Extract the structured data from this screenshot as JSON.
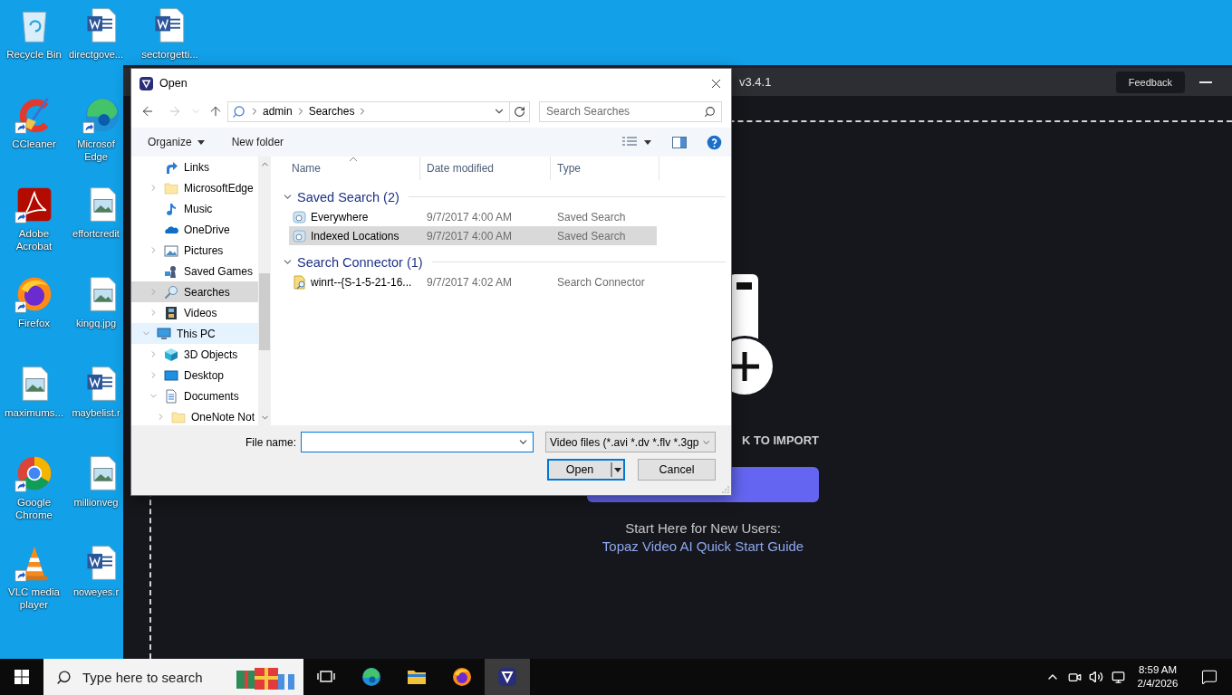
{
  "desktop": {
    "columns": [
      [
        {
          "label": "Recycle Bin",
          "kind": "recycle-bin",
          "shortcut": false
        },
        {
          "label": "CCleaner",
          "kind": "ccleaner",
          "shortcut": true
        },
        {
          "label": "Adobe Acrobat",
          "kind": "acrobat",
          "shortcut": true
        },
        {
          "label": "Firefox",
          "kind": "firefox",
          "shortcut": true
        },
        {
          "label": "maximums...",
          "kind": "image-doc",
          "shortcut": false
        },
        {
          "label": "Google Chrome",
          "kind": "chrome",
          "shortcut": true
        },
        {
          "label": "VLC media player",
          "kind": "vlc",
          "shortcut": true
        }
      ],
      [
        {
          "label": "directgove...",
          "kind": "word-doc",
          "shortcut": false
        },
        {
          "label": "Microsof Edge",
          "kind": "edge",
          "shortcut": true
        },
        {
          "label": "effortcredit",
          "kind": "image-doc",
          "shortcut": false
        },
        {
          "label": "kingq.jpg",
          "kind": "image-doc",
          "shortcut": false
        },
        {
          "label": "maybelist.r",
          "kind": "word-doc",
          "shortcut": false
        },
        {
          "label": "millionveg",
          "kind": "image-doc",
          "shortcut": false
        },
        {
          "label": "noweyes.r",
          "kind": "word-doc",
          "shortcut": false
        }
      ],
      [
        {
          "label": "sectorgetti...",
          "kind": "word-doc",
          "shortcut": false
        }
      ]
    ]
  },
  "app_window": {
    "version": "v3.4.1",
    "feedback_button": "Feedback",
    "import_hint": "K TO IMPORT",
    "help_text": "Start Here for New Users:",
    "guide_link": "Topaz Video AI Quick Start Guide"
  },
  "dialog": {
    "title": "Open",
    "address": {
      "breadcrumbs": [
        "admin",
        "Searches"
      ]
    },
    "search": {
      "placeholder": "Search Searches"
    },
    "toolbar": {
      "organize": "Organize",
      "new_folder": "New folder"
    },
    "nav_pane": {
      "items": [
        {
          "children": [
            {
              "label": "Links",
              "kind": "links",
              "selected": false,
              "hovered": false
            },
            {
              "label": "MicrosoftEdge",
              "kind": "folder",
              "expanded": false,
              "selected": false,
              "hovered": false
            },
            {
              "label": "Music",
              "kind": "music",
              "selected": false,
              "hovered": false
            },
            {
              "label": "OneDrive",
              "kind": "cloud",
              "selected": false,
              "hovered": false
            },
            {
              "label": "Pictures",
              "kind": "pictures",
              "expanded": false,
              "selected": false,
              "hovered": false
            },
            {
              "label": "Saved Games",
              "kind": "games",
              "selected": false,
              "hovered": false
            },
            {
              "label": "Searches",
              "kind": "searches",
              "expanded": false,
              "selected": true,
              "hovered": false
            },
            {
              "label": "Videos",
              "kind": "videos",
              "expanded": false,
              "selected": false,
              "hovered": false
            }
          ]
        },
        {
          "label": "This PC",
          "kind": "computer",
          "expanded": true,
          "selected": false,
          "hovered": true,
          "children": [
            {
              "label": "3D Objects",
              "kind": "cube",
              "expanded": false,
              "selected": false,
              "hovered": false
            },
            {
              "label": "Desktop",
              "kind": "desktop",
              "expanded": false,
              "selected": false,
              "hovered": false
            },
            {
              "label": "Documents",
              "kind": "documents",
              "expanded": true,
              "selected": false,
              "hovered": false,
              "children": [
                {
                  "label": "OneNote Not",
                  "kind": "folder",
                  "expanded": false,
                  "selected": false,
                  "hovered": false
                }
              ]
            }
          ]
        }
      ]
    },
    "file_list": {
      "columns": [
        {
          "label": "Name",
          "sorted": true
        },
        {
          "label": "Date modified",
          "sorted": false
        },
        {
          "label": "Type",
          "sorted": false
        }
      ],
      "groups": [
        {
          "title": "Saved Search (2)",
          "expanded": true,
          "items": [
            {
              "name": "Everywhere",
              "date": "9/7/2017 4:00 AM",
              "type": "Saved Search",
              "kind": "saved-search",
              "selected": false
            },
            {
              "name": "Indexed Locations",
              "date": "9/7/2017 4:00 AM",
              "type": "Saved Search",
              "kind": "saved-search",
              "selected": true
            }
          ]
        },
        {
          "title": "Search Connector (1)",
          "expanded": true,
          "items": [
            {
              "name": "winrt--{S-1-5-21-16...",
              "date": "9/7/2017 4:02 AM",
              "type": "Search Connector",
              "kind": "connector",
              "selected": false
            }
          ]
        }
      ]
    },
    "file_name": {
      "label": "File name:"
    },
    "file_type": "Video files (*.avi *.dv *.flv *.3gp",
    "buttons": {
      "open": "Open",
      "cancel": "Cancel"
    }
  },
  "taskbar": {
    "search": {
      "placeholder": "Type here to search"
    },
    "apps": [
      {
        "kind": "task-view",
        "active": false
      },
      {
        "kind": "edge",
        "active": false
      },
      {
        "kind": "explorer",
        "active": false
      },
      {
        "kind": "firefox",
        "active": false
      },
      {
        "kind": "topaz",
        "active": true
      }
    ],
    "time": "8:59 AM",
    "date": "2/4/2026"
  }
}
